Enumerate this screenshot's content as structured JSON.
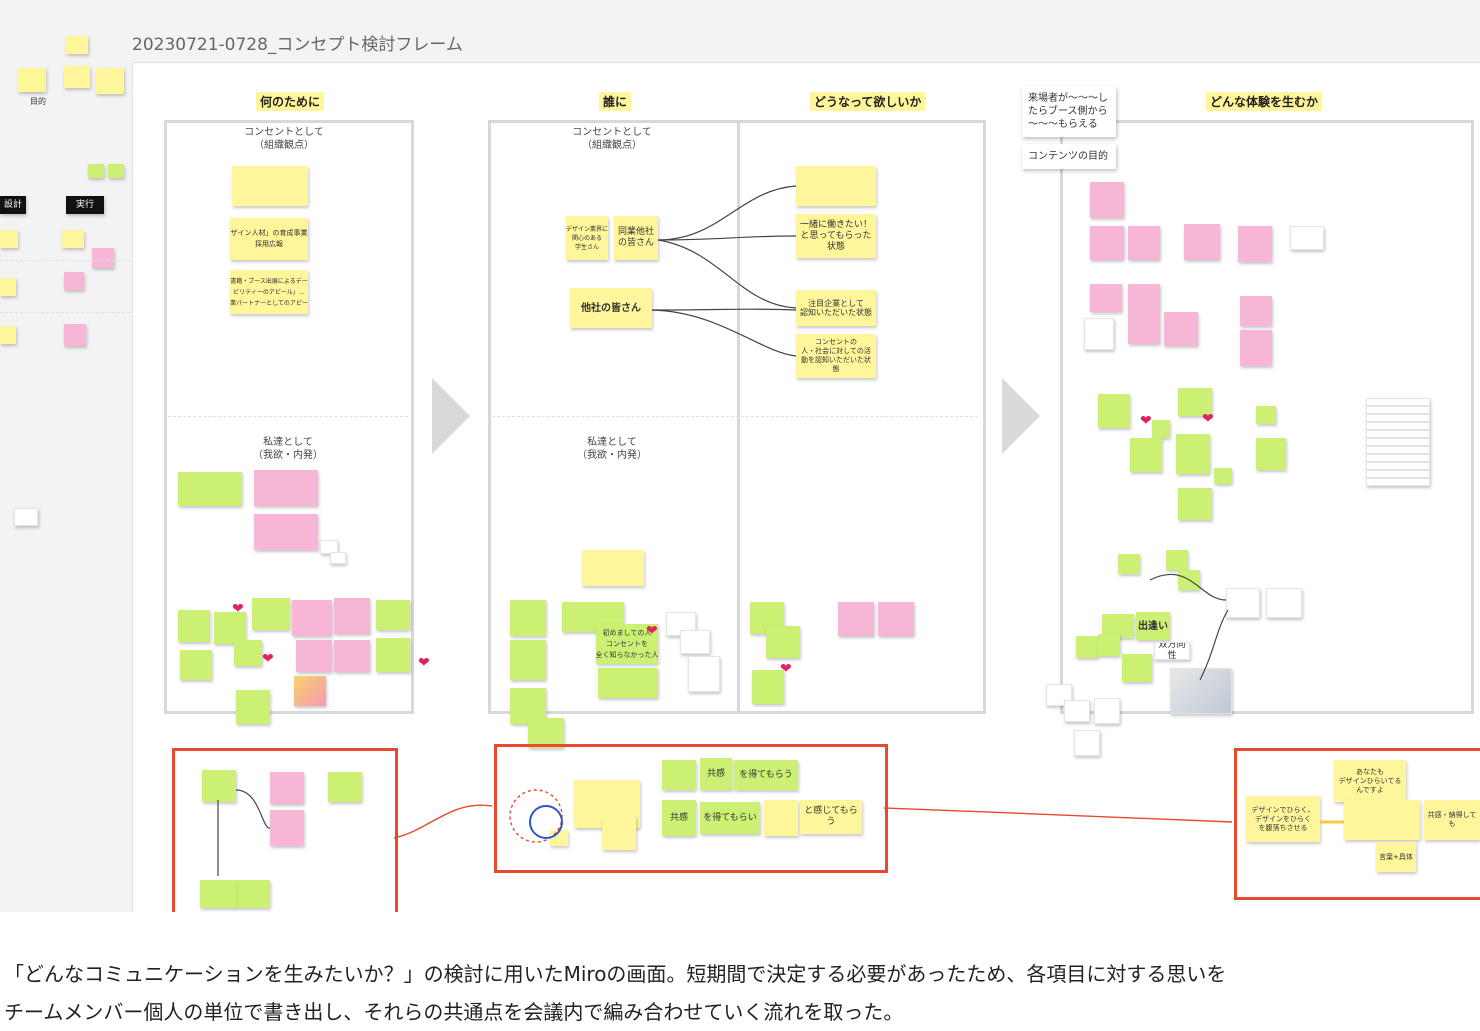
{
  "board": {
    "frame_title": "20230721-0728_コンセプト検討フレーム"
  },
  "columns": {
    "why": "何のために",
    "who": "誰に",
    "want": "どうなって欲しいか",
    "experience": "どんな体験を生むか"
  },
  "sections": {
    "concept": "コンセントとして\n（組織観点）",
    "concept2": "コンセントとして\n（組織観点）",
    "personal": "私達として\n（我欲・内発）",
    "personal2": "私達として\n（我欲・内発）"
  },
  "side_stack": {
    "item1": "来場者が〜〜〜し\nたらブース側から\n〜〜〜もらえる",
    "item2": "コンテンツの目的"
  },
  "left_strip": {
    "black1": "設計",
    "black2": "実行",
    "label1": "目的"
  },
  "notes": {
    "who_students": "デザイン業界に\n関心のある\n学生さん",
    "who_peers": "同業他社\nの皆さん",
    "who_others": "他社の皆さん",
    "want1": "一緒に働きたい！\nと思ってもらった\n状態",
    "want2": "注目企業として\n認知いただいた状態",
    "want3": "コンセントの\n人・社会に対しての活\n動を認知いただいた状\n態",
    "concept_a": "「デザイン人材」の育成事業」…\n採用広報",
    "concept_b": "「書籍・ブース出展によるデータ\nビリティーのアピール」…\n協業パートナーとしてのアピール",
    "exp_deai": "出逢い",
    "exp_sohokou": "双方向性",
    "first_time": "初めましての人\nコンセントを\n全く知らなかった人",
    "get1": "を得てもらう",
    "get2": "を得てもらい",
    "feel": "と感じてもらう",
    "kyokan1": "共感",
    "kyokan2": "共感",
    "right1": "あなたも\nデザインひらいてる\nんですよ",
    "right2": "デザインでひらく、\nデザインをひらく\nを腹落ちさせる",
    "right3": "言葉+具体",
    "right4": "共感・納得しても"
  },
  "caption": {
    "line1": "「どんなコミュニケーションを生みたいか？」の検討に用いたMiroの画面。短期間で決定する必要があったため、各項目に対する思いを",
    "line2": "チームメンバー個人の単位で書き出し、それらの共通点を会議内で編み合わせていく流れを取った。"
  },
  "colors": {
    "sticky_yellow": "#fff59a",
    "sticky_green": "#ccf074",
    "sticky_pink": "#f8b6d6",
    "highlight_red": "#e8492f",
    "arrow_gray": "#d9d9d9"
  }
}
